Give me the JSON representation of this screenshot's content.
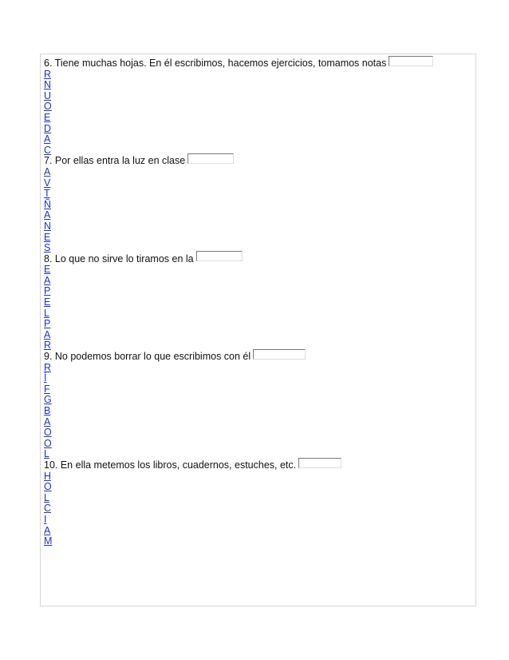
{
  "questions": [
    {
      "text": "6. Tiene muchas  hojas.  En él escribimos, hacemos ejercicios, tomamos notas",
      "letters": [
        "R",
        "N",
        "U",
        "O",
        "E",
        "D",
        "A",
        "C"
      ]
    },
    {
      "text": "7. Por ellas  entra la luz en clase",
      "letters": [
        "A",
        "V",
        "T",
        "Ñ",
        "A",
        "N",
        "E",
        "S"
      ]
    },
    {
      "text": "8. Lo que no sirve lo tiramos en la",
      "letters": [
        "E",
        "A",
        "P",
        "E",
        "L",
        "P",
        "A",
        "R"
      ]
    },
    {
      "text": "9. No podemos borrar lo que escribimos con él",
      "letters": [
        "R",
        "Í",
        "F",
        "G",
        "B",
        "A",
        "O",
        "O",
        "L"
      ]
    },
    {
      "text": "10. En ella metemos los libros, cuadernos,  estuches,  etc.",
      "letters": [
        "H",
        "O",
        "L",
        "C",
        "I",
        "A",
        "M"
      ]
    }
  ]
}
